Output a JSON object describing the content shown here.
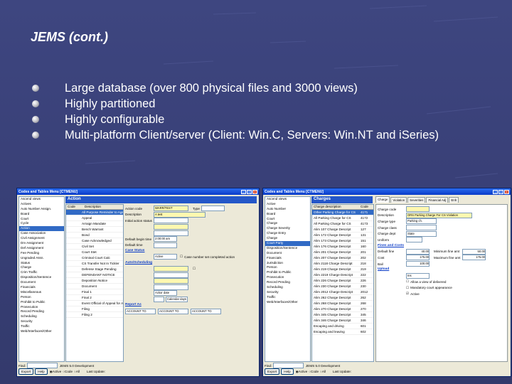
{
  "slide": {
    "title": "JEMS (cont.)",
    "bullets": [
      "Large database (over 800 physical files and 3000 views)",
      "Highly partitioned",
      "Highly configurable",
      "Multi-platform Client/server (Client: Win.C, Servers: Win.NT and iSeries)"
    ]
  },
  "win1": {
    "title": "Codes and Tables Menu [CTMENU]",
    "tree": [
      "Ascend views",
      "Actives",
      "Auto Number Assign.",
      "Board",
      "Court",
      "Cycle",
      "Action",
      "Case Association",
      "Civil Assignment",
      "Drv Assignment",
      "Def Assignment",
      "Fee Pending",
      "Ungraded Assn.",
      "Status",
      "Charge",
      "Crim Traffic",
      "Disposition/Sentence",
      "Document",
      "Financials",
      "Miscellaneous",
      "Person",
      "Prohibit to Public",
      "Prosecution",
      "Record Pending",
      "Scheduling",
      "Security",
      "Traffic",
      "Web/Interfaces/Other"
    ],
    "header": "Action",
    "grid_cols": [
      "Code",
      "Description"
    ],
    "grid_rows": [
      "All Purpose Reminder to Agency",
      "Appeal",
      "Arraign Mandate",
      "Bench Warrant",
      "Bond",
      "Case Acknowledged",
      "Civil Set",
      "Court Stet",
      "Criminal Court Calc",
      "CS Transfer Not In Tickler",
      "Defense Stage Pending",
      "DEFENDANT NOTICE",
      "Deposition Notice",
      "Document",
      "Final 1",
      "Final 2",
      "Event Official of Appeal for Ackor",
      "Filing",
      "Filing 2"
    ],
    "fields": [
      {
        "label": "Action code",
        "value": "WARR/TEST"
      },
      {
        "label": "Description",
        "value": "A test"
      },
      {
        "label": "Initial action status",
        "value": ""
      },
      {
        "label": "Default begin time",
        "value": "2:00:00 am"
      },
      {
        "label": "Default time",
        "value": ""
      }
    ],
    "sec_status": "Case Status",
    "status_value": "Active",
    "chk_label": "Case number set completed action",
    "sec_auto": "Auto/Scheduling",
    "sched_value": "Ackor date",
    "calendar_days": "Calendar days",
    "sec_report": "Report As",
    "report_values": [
      "ACCOUNT TO",
      "ACCOUNT TO",
      "ACCOUNT TO"
    ],
    "bottom": {
      "find_label": "Find:",
      "dev_text": "JEMS 5.0 Development",
      "buttons": [
        "Export",
        "Help"
      ],
      "radios": [
        "Active",
        "Code",
        "All"
      ],
      "last_update": "Last Update:"
    }
  },
  "win2": {
    "title": "Codes and Tables Menu [CTMENU]",
    "tree": [
      "Ascend views",
      "Active",
      "Auto Number",
      "Board",
      "Court",
      "Charge",
      "Charge Severity",
      "Charge Entry",
      "Charge",
      "Court Party",
      "Disposition/Sentence",
      "Document",
      "Financials",
      "Jurisdiction",
      "Person",
      "Prohibit to Public",
      "Prosecution",
      "Record Pending",
      "Scheduling",
      "Security",
      "Traffic",
      "Web/Interfaces/Other"
    ],
    "header": "Charges",
    "grid_cols": [
      "Charge description",
      "Code"
    ],
    "grid_rows": [
      "Other Parking Charge for CS",
      "All Parking Charge for CS",
      "All Parking Charge for CS",
      "Alim 107 Charge Descript",
      "Alim 172 Charge Descript",
      "Alim 173 Charge Descript",
      "Alim 176 Charge Descript",
      "Alim 201 Charge Descript",
      "Alim 207 Charge Descript",
      "Alim 2118 Charge Descript",
      "Alim 219 Charge Descript",
      "Alim 2219 Charge Descript",
      "Alim 226 Charge Descript",
      "Alim 230 Charge Descript",
      "Alim 2012 Charge Descript",
      "Alim 262 Charge Descript",
      "Alim 268 Charge Descript",
      "Alim 270 Charge Descript",
      "Alim 345 Charge Descript",
      "Alim 346 Charge Descript",
      "Escaping and driving",
      "Escaping and leaving"
    ],
    "grid_codes": [
      "4171",
      "4172",
      "4173",
      "127",
      "131",
      "151",
      "160",
      "201",
      "202",
      "218",
      "219",
      "222",
      "226",
      "230",
      "2012",
      "262",
      "268",
      "270",
      "345",
      "346",
      "601",
      "602"
    ],
    "tabs": [
      "Charge",
      "Violation",
      "Severities",
      "Financial Adj",
      "Enh"
    ],
    "fields": [
      {
        "label": "Charge code",
        "value": ""
      },
      {
        "label": "Description",
        "value": "ORS Parking Charge For CS Violation"
      },
      {
        "label": "Charge type",
        "value": "Parking ch."
      },
      {
        "label": "Charge class",
        "value": ""
      },
      {
        "label": "Charge dept",
        "value": "State"
      },
      {
        "label": "Uniform",
        "value": ""
      }
    ],
    "sec_fines": "Fines and Costs",
    "fines": [
      {
        "label": "Default fine",
        "value": "40.00",
        "max_label": "Minimum fine amt",
        "max_value": "50.00"
      },
      {
        "label": "Cost",
        "value": "175.00",
        "max_label": "Maximum fine amt",
        "max_value": "175.00"
      },
      {
        "label": "Bail",
        "value": "100.00",
        "max_label": "",
        "max_value": ""
      }
    ],
    "sec_upload": "Upload",
    "upload_value": "Ins",
    "checks": [
      "Allow a view of delivered",
      "Mandatory court appearance",
      "Active"
    ],
    "bottom": {
      "find_label": "Find:",
      "dev_text": "JEMS 5.0 Development",
      "buttons": [
        "Export",
        "Help"
      ],
      "radios": [
        "Active",
        "Code",
        "All"
      ],
      "last_update": "Last Update:"
    }
  }
}
